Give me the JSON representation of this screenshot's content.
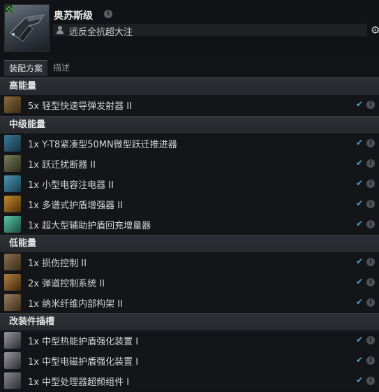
{
  "header": {
    "ship_name": "奥苏斯级",
    "info_icon": "i",
    "fitting_name": "远反全抗超大注",
    "gear_icon": "⚙"
  },
  "tabs": [
    {
      "label": "装配方案",
      "active": true
    },
    {
      "label": "描述",
      "active": false
    }
  ],
  "sections": [
    {
      "title": "高能量",
      "modules": [
        {
          "label": "5x 轻型快速导弹发射器 II",
          "icon": "launcher-icon"
        }
      ]
    },
    {
      "title": "中级能量",
      "modules": [
        {
          "label": "1x Y-T8紧凑型50MN微型跃迁推进器",
          "icon": "microwarpdrive-icon"
        },
        {
          "label": "1x 跃迁扰断器 II",
          "icon": "warp-disruptor-icon"
        },
        {
          "label": "1x 小型电容注电器 II",
          "icon": "cap-injector-icon"
        },
        {
          "label": "1x 多谱式护盾增强器 II",
          "icon": "shield-hardener-icon"
        },
        {
          "label": "1x 超大型辅助护盾回充增量器",
          "icon": "shield-booster-icon"
        }
      ]
    },
    {
      "title": "低能量",
      "modules": [
        {
          "label": "1x 损伤控制 II",
          "icon": "damage-control-icon"
        },
        {
          "label": "2x 弹道控制系统 II",
          "icon": "ballistic-control-icon"
        },
        {
          "label": "1x 纳米纤维内部构架 II",
          "icon": "nanofiber-icon"
        }
      ]
    },
    {
      "title": "改装件插槽",
      "modules": [
        {
          "label": "1x 中型热能护盾强化装置 I",
          "icon": "rig-icon"
        },
        {
          "label": "1x 中型电磁护盾强化装置 I",
          "icon": "rig-icon"
        },
        {
          "label": "1x 中型处理器超频组件 I",
          "icon": "rig-icon"
        }
      ]
    }
  ],
  "row_status": {
    "check": "✔",
    "info": "i"
  },
  "colors": {
    "accent": "#4aa3d8",
    "section_bg": "#2d3036",
    "row_bg": "#141518"
  }
}
